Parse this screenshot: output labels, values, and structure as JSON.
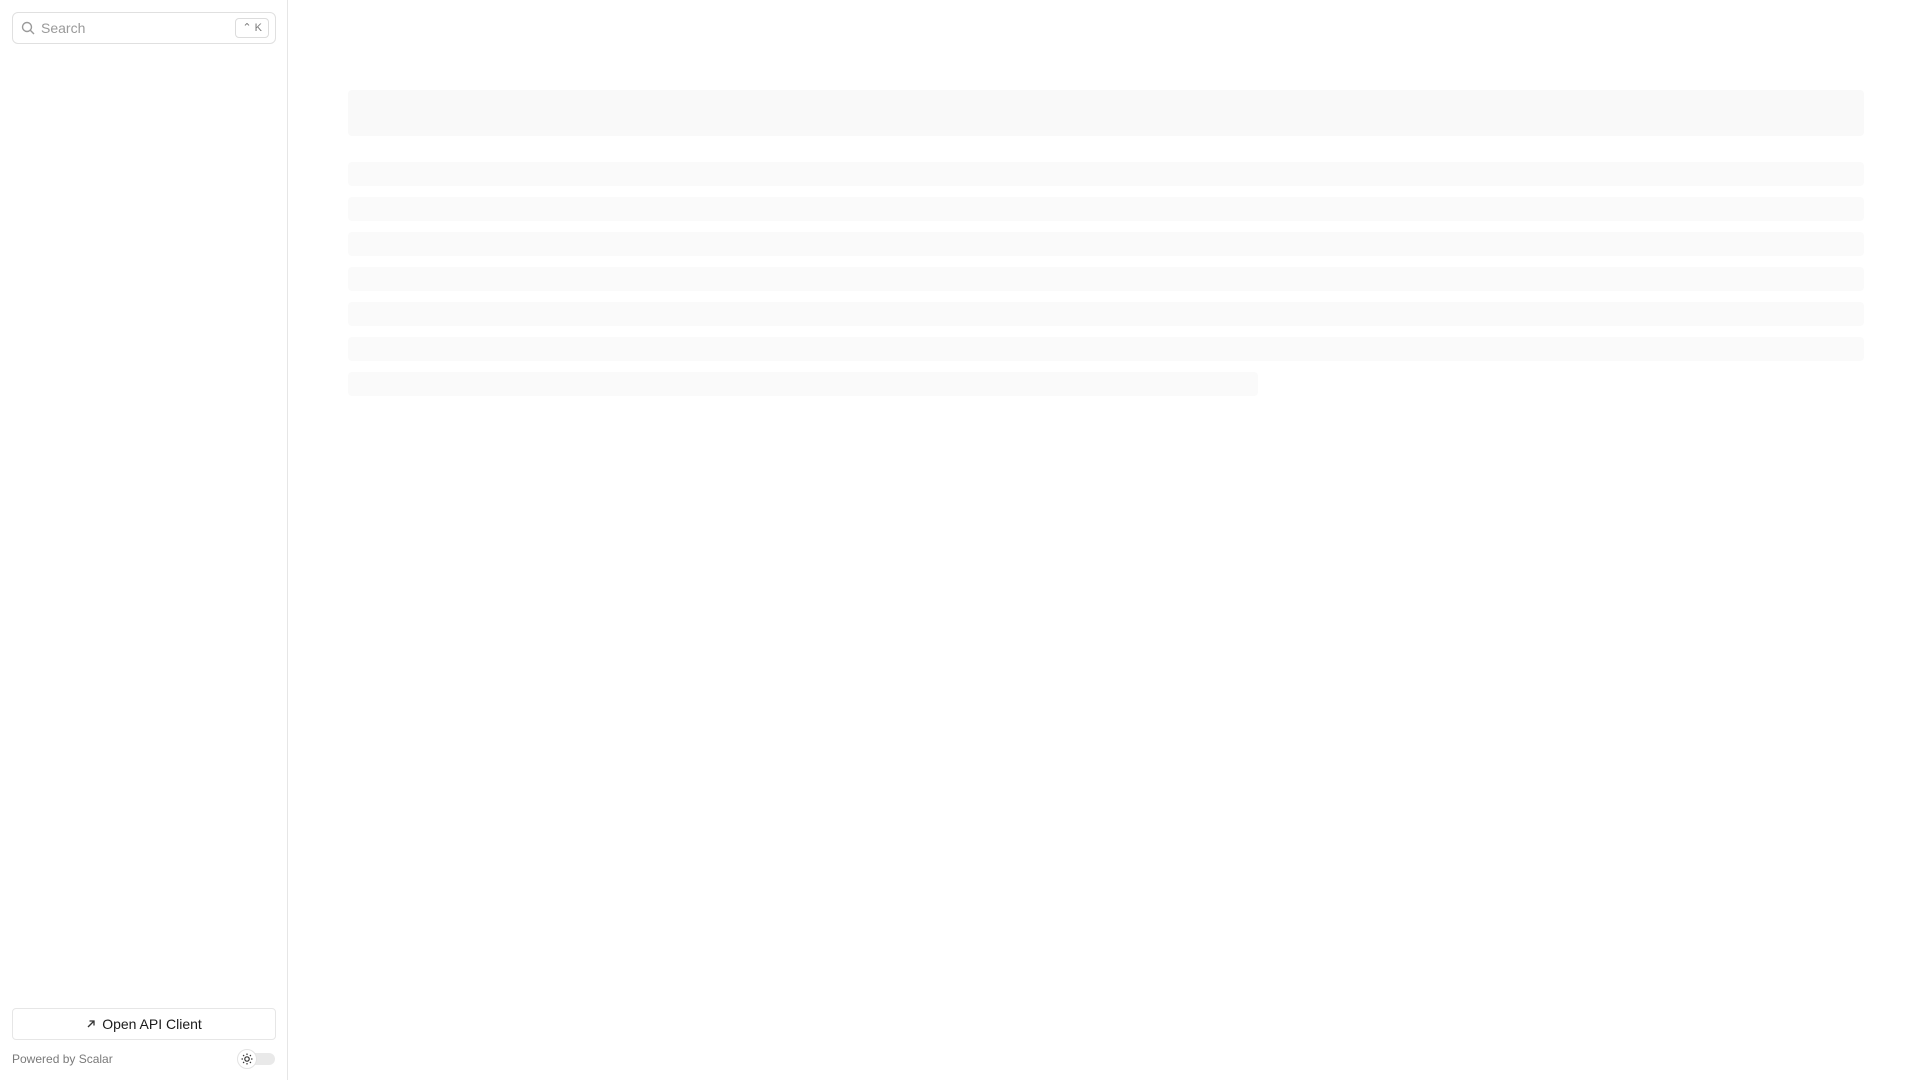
{
  "sidebar": {
    "search": {
      "placeholder": "Search",
      "shortcut": "⌃ K",
      "icon": "search-icon"
    },
    "open_client": {
      "label": "Open API Client",
      "icon": "arrow-up-right-icon"
    },
    "powered_by": "Powered by Scalar",
    "theme_toggle": {
      "icon": "sun-icon",
      "state": "light"
    }
  },
  "main": {
    "state": "loading"
  },
  "colors": {
    "border": "#e6e6e6",
    "skeleton": "#fafafa",
    "muted_text": "#7a7a7a"
  }
}
